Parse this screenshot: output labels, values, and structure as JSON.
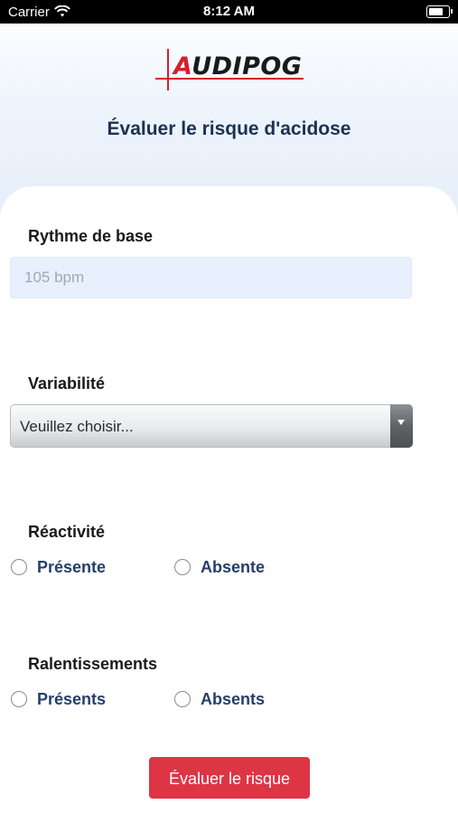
{
  "status_bar": {
    "carrier": "Carrier",
    "time": "8:12 AM",
    "battery_level": 0.85
  },
  "logo": {
    "text_rest": "UDIPOG",
    "text_a": "A"
  },
  "page_title": "Évaluer le risque d'acidose",
  "form": {
    "baseline": {
      "label": "Rythme de base",
      "placeholder": "105 bpm",
      "value": ""
    },
    "variability": {
      "label": "Variabilité",
      "selected": "Veuillez choisir..."
    },
    "reactivity": {
      "label": "Réactivité",
      "options": [
        "Présente",
        "Absente"
      ]
    },
    "decelerations": {
      "label": "Ralentissements",
      "options": [
        "Présents",
        "Absents"
      ]
    },
    "submit_label": "Évaluer le risque"
  },
  "colors": {
    "brand_red": "#d3202e",
    "title_navy": "#1c3250",
    "option_blue": "#253f6a",
    "button_red": "#de3545"
  }
}
